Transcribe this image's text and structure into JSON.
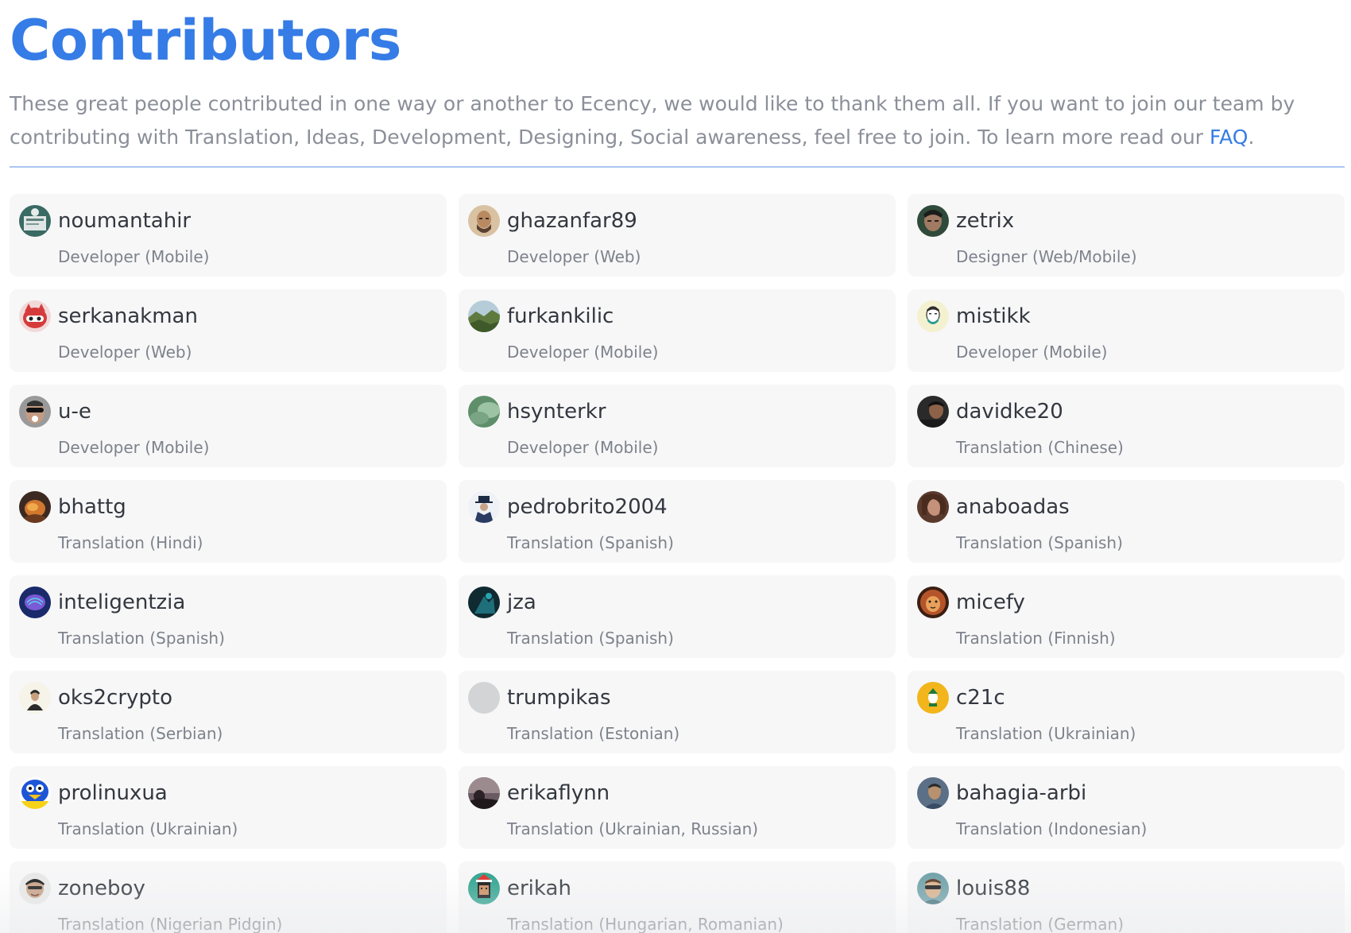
{
  "header": {
    "title": "Contributors",
    "intro_text": "These great people contributed in one way or another to Ecency, we would like to thank them all. If you want to join our team by contributing with Translation, Ideas, Development, Designing, Social awareness, feel free to join. To learn more read our ",
    "faq_link": "FAQ",
    "intro_end": "."
  },
  "colors": {
    "accent": "#357ce6",
    "card_bg": "#f7f7f8",
    "muted_text": "#7d828b"
  },
  "contributors": [
    {
      "username": "noumantahir",
      "role": "Developer (Mobile)",
      "avatar_icon": "avatar-image"
    },
    {
      "username": "ghazanfar89",
      "role": "Developer (Web)",
      "avatar_icon": "avatar-image"
    },
    {
      "username": "zetrix",
      "role": "Designer (Web/Mobile)",
      "avatar_icon": "avatar-image"
    },
    {
      "username": "serkanakman",
      "role": "Developer (Web)",
      "avatar_icon": "avatar-image"
    },
    {
      "username": "furkankilic",
      "role": "Developer (Mobile)",
      "avatar_icon": "avatar-image"
    },
    {
      "username": "mistikk",
      "role": "Developer (Mobile)",
      "avatar_icon": "avatar-image"
    },
    {
      "username": "u-e",
      "role": "Developer (Mobile)",
      "avatar_icon": "avatar-image"
    },
    {
      "username": "hsynterkr",
      "role": "Developer (Mobile)",
      "avatar_icon": "avatar-image"
    },
    {
      "username": "davidke20",
      "role": "Translation (Chinese)",
      "avatar_icon": "avatar-image"
    },
    {
      "username": "bhattg",
      "role": "Translation (Hindi)",
      "avatar_icon": "avatar-image"
    },
    {
      "username": "pedrobrito2004",
      "role": "Translation (Spanish)",
      "avatar_icon": "avatar-image"
    },
    {
      "username": "anaboadas",
      "role": "Translation (Spanish)",
      "avatar_icon": "avatar-image"
    },
    {
      "username": "inteligentzia",
      "role": "Translation (Spanish)",
      "avatar_icon": "avatar-image"
    },
    {
      "username": "jza",
      "role": "Translation (Spanish)",
      "avatar_icon": "avatar-image"
    },
    {
      "username": "micefy",
      "role": "Translation (Finnish)",
      "avatar_icon": "avatar-image"
    },
    {
      "username": "oks2crypto",
      "role": "Translation (Serbian)",
      "avatar_icon": "avatar-image"
    },
    {
      "username": "trumpikas",
      "role": "Translation (Estonian)",
      "avatar_icon": "avatar-placeholder"
    },
    {
      "username": "c21c",
      "role": "Translation (Ukrainian)",
      "avatar_icon": "avatar-image"
    },
    {
      "username": "prolinuxua",
      "role": "Translation (Ukrainian)",
      "avatar_icon": "avatar-image"
    },
    {
      "username": "erikaflynn",
      "role": "Translation (Ukrainian, Russian)",
      "avatar_icon": "avatar-image"
    },
    {
      "username": "bahagia-arbi",
      "role": "Translation (Indonesian)",
      "avatar_icon": "avatar-image"
    },
    {
      "username": "zoneboy",
      "role": "Translation (Nigerian Pidgin)",
      "avatar_icon": "avatar-image"
    },
    {
      "username": "erikah",
      "role": "Translation (Hungarian, Romanian)",
      "avatar_icon": "avatar-image"
    },
    {
      "username": "louis88",
      "role": "Translation (German)",
      "avatar_icon": "avatar-image"
    }
  ]
}
